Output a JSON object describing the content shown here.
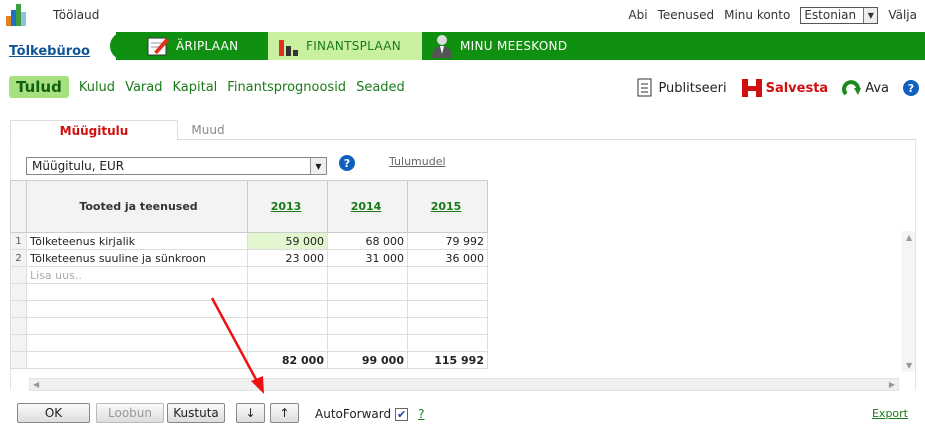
{
  "top": {
    "home_label": "Töölaud",
    "links": [
      "Abi",
      "Teenused",
      "Minu konto"
    ],
    "language": "Estonian",
    "logout": "Välja"
  },
  "company": "Tõlkebüroo",
  "nav": [
    {
      "label": "ÄRIPLAAN",
      "icon": "business-plan-icon"
    },
    {
      "label": "FINANTSPLAAN",
      "icon": "bar-chart-icon",
      "active": true
    },
    {
      "label": "MINU MEESKOND",
      "icon": "team-icon"
    }
  ],
  "subnav": [
    "Tulud",
    "Kulud",
    "Varad",
    "Kapital",
    "Finantsprognoosid",
    "Seaded"
  ],
  "actions": {
    "publish": "Publitseeri",
    "save": "Salvesta",
    "open": "Ava"
  },
  "tabs": [
    "Müügitulu",
    "Muud"
  ],
  "selector": "Müügitulu, EUR",
  "model_link": "Tulumudel",
  "grid": {
    "header": "Tooted ja teenused",
    "years": [
      "2013",
      "2014",
      "2015"
    ],
    "rows": [
      {
        "n": "1",
        "name": "Tõlketeenus kirjalik",
        "values": [
          "59 000",
          "68 000",
          "79 992"
        ]
      },
      {
        "n": "2",
        "name": "Tõlketeenus suuline ja sünkroon",
        "values": [
          "23 000",
          "31 000",
          "36 000"
        ]
      }
    ],
    "placeholder": "Lisa uus..",
    "totals": [
      "82 000",
      "99 000",
      "115 992"
    ]
  },
  "buttons": {
    "ok": "OK",
    "cancel": "Loobun",
    "delete": "Kustuta",
    "down": "↓",
    "up": "↑"
  },
  "autoforward": {
    "label": "AutoForward",
    "checked": true,
    "help": "?"
  },
  "export": "Export",
  "colors": {
    "brand_green": "#109010",
    "active_tab_bg": "#c8f0a0",
    "save_red": "#d01010",
    "arrow_red": "#ee1111"
  }
}
